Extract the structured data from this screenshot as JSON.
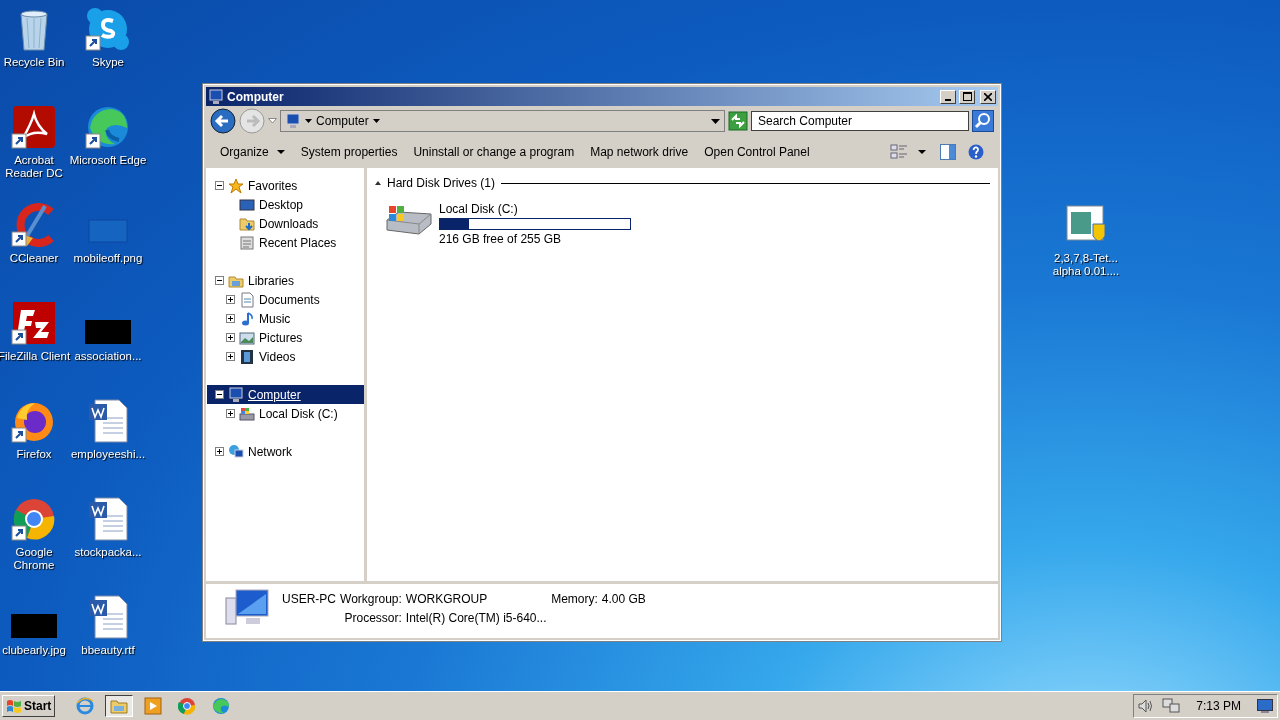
{
  "desktop": {
    "icons": [
      {
        "label": "Recycle Bin",
        "kind": "recycle",
        "shortcut": false
      },
      {
        "label": "Skype",
        "kind": "chat",
        "shortcut": true
      },
      {
        "label": "Acrobat Reader DC",
        "kind": "pdf",
        "shortcut": true
      },
      {
        "label": "Microsoft Edge",
        "kind": "edge",
        "shortcut": true
      },
      {
        "label": "CCleaner",
        "kind": "cleaner",
        "shortcut": true
      },
      {
        "label": "mobileoff.png",
        "kind": "blank-image",
        "shortcut": false
      },
      {
        "label": "FileZilla Client",
        "kind": "ftp",
        "shortcut": true
      },
      {
        "label": "association...",
        "kind": "black-image",
        "shortcut": false
      },
      {
        "label": "Firefox",
        "kind": "firefox",
        "shortcut": true
      },
      {
        "label": "employeeshi...",
        "kind": "word",
        "shortcut": false
      },
      {
        "label": "Google Chrome",
        "kind": "chrome",
        "shortcut": true
      },
      {
        "label": "stockpacka...",
        "kind": "word",
        "shortcut": false
      },
      {
        "label": "clubearly.jpg",
        "kind": "black-image",
        "shortcut": false
      },
      {
        "label": "bbeauty.rtf",
        "kind": "word",
        "shortcut": false
      }
    ],
    "side_icons": [
      {
        "label": "2,3,7,8-Tet...\nalpha 0.01....",
        "kind": "installer",
        "shortcut": false
      }
    ]
  },
  "window": {
    "title": "Computer",
    "address": {
      "crumbs": [
        "Computer"
      ]
    },
    "search": {
      "placeholder": "Search Computer"
    },
    "toolbar": [
      {
        "label": "Organize",
        "dropdown": true
      },
      {
        "label": "System properties",
        "dropdown": false
      },
      {
        "label": "Uninstall or change a program",
        "dropdown": false
      },
      {
        "label": "Map network drive",
        "dropdown": false
      },
      {
        "label": "Open Control Panel",
        "dropdown": false
      }
    ],
    "tree": [
      {
        "label": "Favorites",
        "kind": "favorites",
        "expanded": true,
        "selected": false,
        "children": [
          {
            "label": "Desktop",
            "kind": "desktop",
            "selected": false
          },
          {
            "label": "Downloads",
            "kind": "downloads",
            "selected": false
          },
          {
            "label": "Recent Places",
            "kind": "recent",
            "selected": false
          }
        ]
      },
      {
        "label": "Libraries",
        "kind": "libraries",
        "expanded": true,
        "selected": false,
        "children": [
          {
            "label": "Documents",
            "kind": "documents",
            "expanded": false,
            "selected": false
          },
          {
            "label": "Music",
            "kind": "music",
            "expanded": false,
            "selected": false
          },
          {
            "label": "Pictures",
            "kind": "pictures",
            "expanded": false,
            "selected": false
          },
          {
            "label": "Videos",
            "kind": "videos",
            "expanded": false,
            "selected": false
          }
        ]
      },
      {
        "label": "Computer",
        "kind": "computer",
        "expanded": true,
        "selected": true,
        "children": [
          {
            "label": "Local Disk (C:)",
            "kind": "disk",
            "expanded": false,
            "selected": false
          }
        ]
      },
      {
        "label": "Network",
        "kind": "network",
        "expanded": false,
        "selected": false
      }
    ],
    "group": {
      "title": "Hard Disk Drives (1)",
      "expanded": true,
      "drives": [
        {
          "name": "Local Disk (C:)",
          "level": 0.15,
          "free": "216 GB free of 255 GB"
        }
      ]
    },
    "details": {
      "name": "USER-PC",
      "fields": [
        {
          "label": "Workgroup:",
          "value": "WORKGROUP"
        },
        {
          "label": "Memory:",
          "value": "4.00 GB"
        },
        {
          "label": "Processor:",
          "value": "Intel(R) Core(TM) i5-640..."
        }
      ]
    }
  },
  "taskbar": {
    "start": "Start",
    "apps": [
      {
        "kind": "ie",
        "selected": false
      },
      {
        "kind": "explorer",
        "selected": true
      },
      {
        "kind": "media",
        "selected": false
      },
      {
        "kind": "chrome",
        "selected": false
      },
      {
        "kind": "edge",
        "selected": false
      }
    ],
    "clock": "7:13 PM"
  }
}
